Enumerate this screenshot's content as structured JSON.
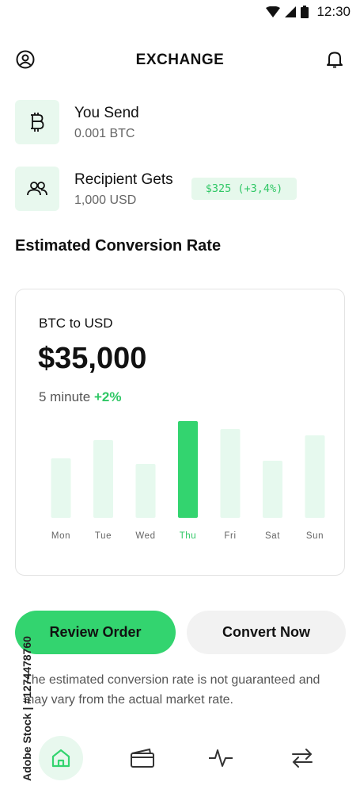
{
  "status_bar": {
    "time": "12:30"
  },
  "header": {
    "title": "EXCHANGE",
    "left_icon": "profile-icon",
    "right_icon": "bell-icon"
  },
  "send": {
    "title": "You Send",
    "amount": "0.001 BTC",
    "icon": "bitcoin-icon"
  },
  "receive": {
    "title": "Recipient Gets",
    "amount": "1,000 USD",
    "gain": "$325 (+3,4%)",
    "icon": "users-icon"
  },
  "section_title": "Estimated Conversion Rate",
  "rate_card": {
    "pair": "BTC to USD",
    "rate": "$35,000",
    "period": "5 minute",
    "change": "+2%"
  },
  "chart_data": {
    "type": "bar",
    "categories": [
      "Mon",
      "Tue",
      "Wed",
      "Thu",
      "Fri",
      "Sat",
      "Sun"
    ],
    "values": [
      75,
      98,
      68,
      122,
      112,
      72,
      104
    ],
    "highlight": "Thu",
    "colors": {
      "bar": "#e6f9ee",
      "highlight": "#33d46f",
      "label": "#666666",
      "highlight_label": "#2fc765"
    }
  },
  "actions": {
    "primary": "Review Order",
    "secondary": "Convert Now"
  },
  "disclaimer": "The estimated conversion rate is not guaranteed and may vary from the actual market rate.",
  "watermark": "Adobe Stock | #1274478760",
  "nav": [
    {
      "icon": "home-icon",
      "active": true
    },
    {
      "icon": "wallet-icon",
      "active": false
    },
    {
      "icon": "activity-icon",
      "active": false
    },
    {
      "icon": "swap-icon",
      "active": false
    }
  ],
  "colors": {
    "accent": "#33d46f",
    "accent_light": "#e8f8ee",
    "text": "#111111",
    "muted": "#666666"
  }
}
